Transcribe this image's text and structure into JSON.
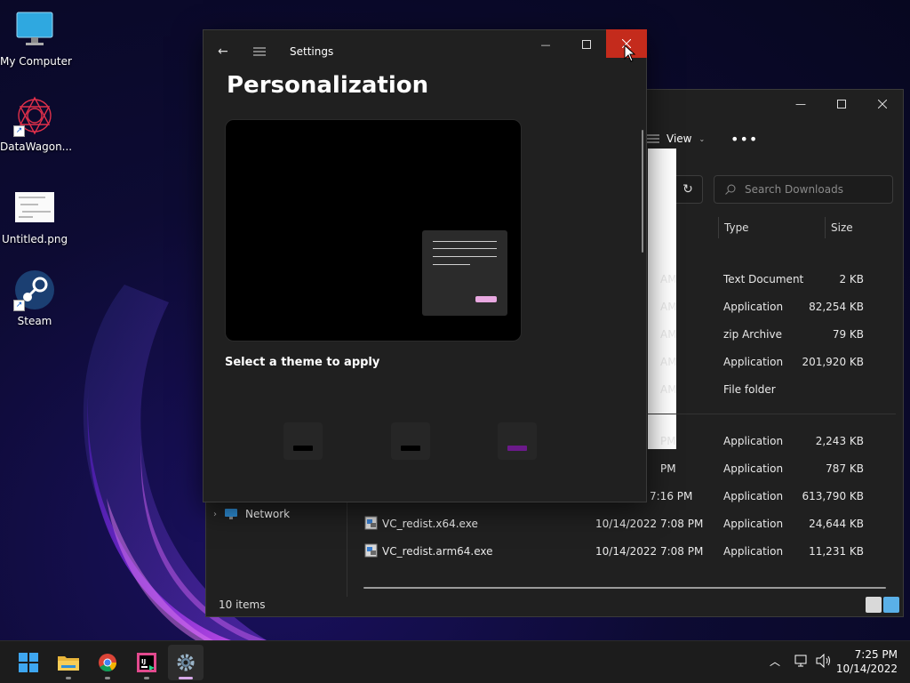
{
  "desktop": {
    "icons": [
      {
        "label": "My Computer",
        "icon": "monitor-icon"
      },
      {
        "label": "DataWagon...",
        "icon": "datawagon-logo-icon"
      },
      {
        "label": "Untitled.png",
        "icon": "image-file-icon"
      },
      {
        "label": "Steam",
        "icon": "steam-icon"
      }
    ]
  },
  "settings": {
    "app_title": "Settings",
    "page_title": "Personalization",
    "select_theme_label": "Select a theme to apply",
    "theme_accents": [
      "#000000",
      "#000000",
      "#6b1a8a"
    ],
    "preview_accent": "#e8a8e0"
  },
  "explorer": {
    "toolbar": {
      "view_label": "View",
      "more_label": "•••"
    },
    "search_placeholder": "Search Downloads",
    "columns": {
      "type": "Type",
      "size": "Size"
    },
    "rows": [
      {
        "name": "",
        "date": "AM",
        "type": "Text Document",
        "size": "2 KB"
      },
      {
        "name": "",
        "date": "AM",
        "type": "Application",
        "size": "82,254 KB"
      },
      {
        "name": "",
        "date": "AM",
        "type": "zip Archive",
        "size": "79 KB"
      },
      {
        "name": "",
        "date": "AM",
        "type": "Application",
        "size": "201,920 KB"
      },
      {
        "name": "",
        "date": "AM",
        "type": "File folder",
        "size": ""
      },
      {
        "name": "",
        "date": "PM",
        "type": "Application",
        "size": "2,243 KB"
      },
      {
        "name": "",
        "date": "PM",
        "type": "Application",
        "size": "787 KB"
      },
      {
        "name": "",
        "date": "7:16 PM",
        "type": "Application",
        "size": "613,790 KB"
      },
      {
        "name": "VC_redist.x64.exe",
        "date": "10/14/2022 7:08 PM",
        "type": "Application",
        "size": "24,644 KB"
      },
      {
        "name": "VC_redist.arm64.exe",
        "date": "10/14/2022 7:08 PM",
        "type": "Application",
        "size": "11,231 KB"
      }
    ],
    "nav_network_label": "Network",
    "status_text": "10 items"
  },
  "taskbar": {
    "apps": [
      "start-icon",
      "file-explorer-icon",
      "chrome-icon",
      "intellij-icon",
      "settings-gear-icon"
    ],
    "time": "7:25 PM",
    "date": "10/14/2022"
  },
  "colors": {
    "close_red": "#c42b1c",
    "accent_pink": "#d6a8e8"
  }
}
